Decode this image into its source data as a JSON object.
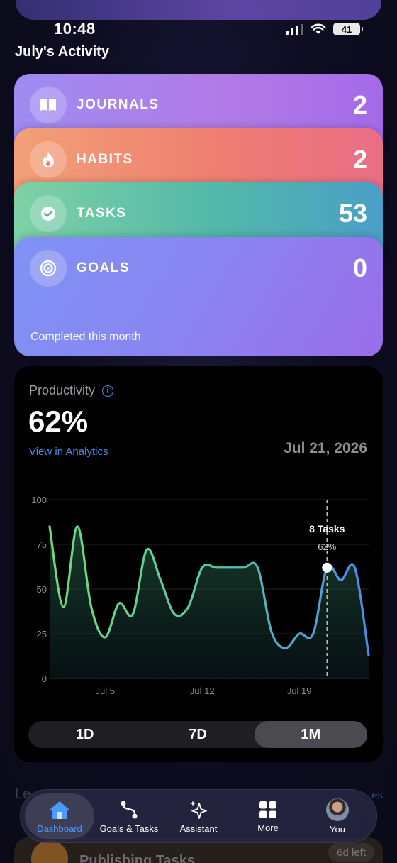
{
  "status": {
    "time": "10:48",
    "battery": "41"
  },
  "section": {
    "title": "July's Activity"
  },
  "activity": {
    "items": [
      {
        "label": "JOURNALS",
        "value": "2",
        "icon": "book-icon"
      },
      {
        "label": "HABITS",
        "value": "2",
        "icon": "flame-icon"
      },
      {
        "label": "TASKS",
        "value": "53",
        "icon": "checkmark-icon"
      },
      {
        "label": "GOALS",
        "value": "0",
        "icon": "target-icon"
      }
    ],
    "footer": "Completed this month"
  },
  "productivity": {
    "title": "Productivity",
    "value": "62%",
    "link": "View in Analytics",
    "date": "Jul 21, 2026",
    "tooltip": {
      "title": "8 Tasks",
      "value": "62%"
    },
    "ranges": [
      "1D",
      "7D",
      "1M"
    ],
    "selected_range": "1M"
  },
  "chart_data": {
    "type": "area",
    "x": [
      1,
      2,
      3,
      4,
      5,
      6,
      7,
      8,
      9,
      10,
      11,
      12,
      13,
      14,
      15,
      16,
      17,
      18,
      19,
      20,
      21,
      22
    ],
    "values": [
      85,
      40,
      85,
      40,
      23,
      42,
      36,
      72,
      55,
      36,
      40,
      62,
      62,
      62,
      62,
      62,
      26,
      17,
      25,
      25,
      62,
      55,
      62,
      13
    ],
    "y_ticks": [
      "0",
      "25",
      "50",
      "75",
      "100"
    ],
    "x_ticks": [
      "Jul 5",
      "Jul 12",
      "Jul 19"
    ],
    "ylim": [
      0,
      100
    ],
    "highlight_index": 20,
    "grid": true
  },
  "below": {
    "title": "Le",
    "link": "es",
    "task": "Publishing Tasks",
    "badge": "6d left"
  },
  "tabs": [
    {
      "label": "Dashboard",
      "icon": "house-icon",
      "active": true
    },
    {
      "label": "Goals & Tasks",
      "icon": "path-icon",
      "active": false
    },
    {
      "label": "Assistant",
      "icon": "sparkles-icon",
      "active": false
    },
    {
      "label": "More",
      "icon": "grid-icon",
      "active": false
    },
    {
      "label": "You",
      "icon": "avatar-icon",
      "active": false
    }
  ]
}
